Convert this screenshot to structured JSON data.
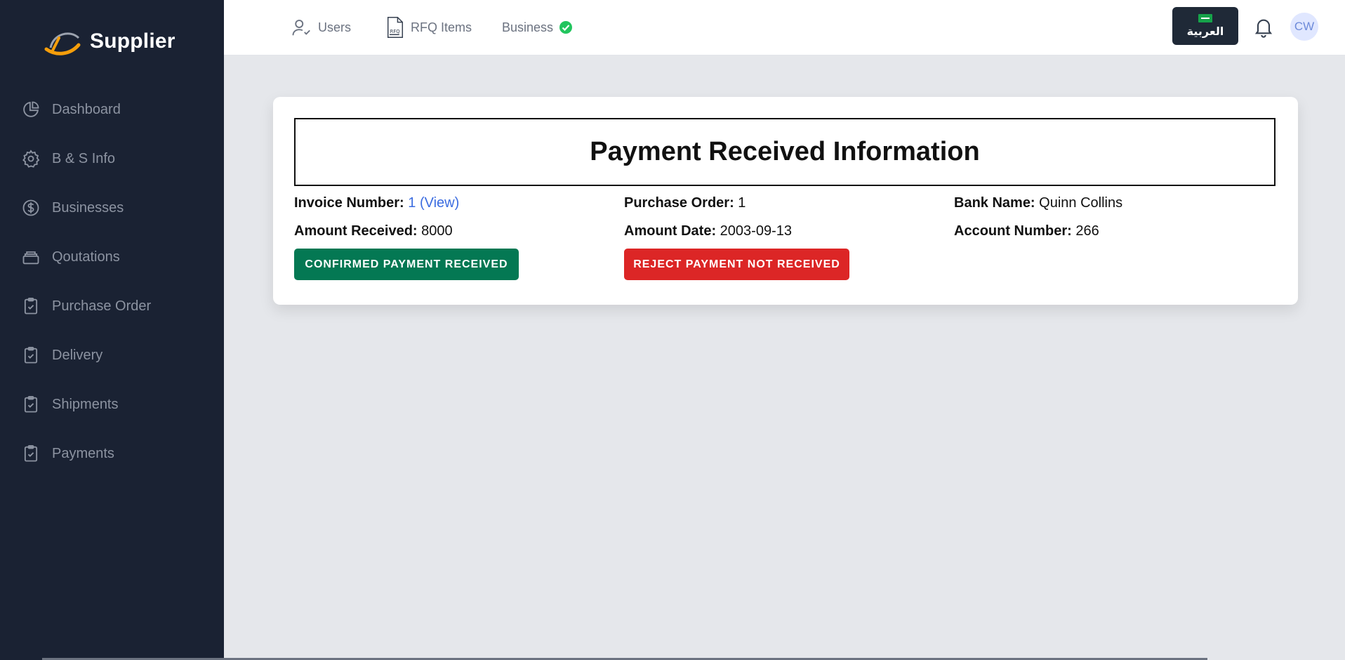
{
  "brand": {
    "name": "Supplier",
    "logo_icon": "supplier-logo",
    "logo_color": "#f59e0b"
  },
  "sidebar": {
    "items": [
      {
        "label": "Dashboard",
        "icon": "pie-chart-icon"
      },
      {
        "label": "B & S Info",
        "icon": "gear-icon"
      },
      {
        "label": "Businesses",
        "icon": "dollar-circle-icon"
      },
      {
        "label": "Qoutations",
        "icon": "stack-icon"
      },
      {
        "label": "Purchase Order",
        "icon": "clipboard-check-icon"
      },
      {
        "label": "Delivery",
        "icon": "clipboard-check-icon"
      },
      {
        "label": "Shipments",
        "icon": "clipboard-check-icon"
      },
      {
        "label": "Payments",
        "icon": "clipboard-check-icon"
      }
    ]
  },
  "topbar": {
    "users_label": "Users",
    "rfq_label": "RFQ Items",
    "business_label": "Business",
    "language_label": "العربية",
    "avatar_initials": "CW"
  },
  "payment": {
    "title": "Payment Received Information",
    "invoice_label": "Invoice Number:",
    "invoice_value": "1 (View)",
    "purchase_order_label": "Purchase Order:",
    "purchase_order_value": "1",
    "bank_name_label": "Bank Name:",
    "bank_name_value": "Quinn Collins",
    "amount_received_label": "Amount Received:",
    "amount_received_value": "8000",
    "amount_date_label": "Amount Date:",
    "amount_date_value": "2003-09-13",
    "account_number_label": "Account Number:",
    "account_number_value": "266",
    "confirm_button": "CONFIRMED PAYMENT RECEIVED",
    "reject_button": "REJECT PAYMENT NOT RECEIVED"
  },
  "colors": {
    "sidebar_bg": "#1a2233",
    "confirm": "#047853",
    "reject": "#dc2626",
    "link": "#3b6ce0",
    "verified": "#22c55e"
  }
}
